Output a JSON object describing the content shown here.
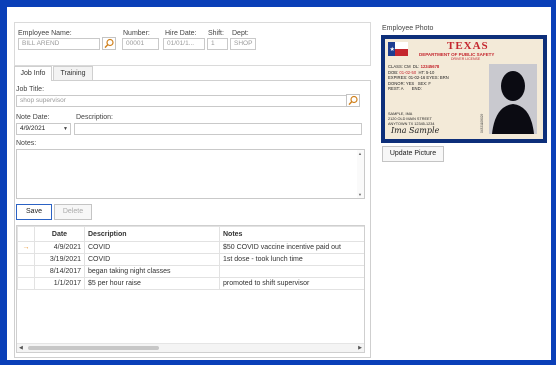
{
  "header": {
    "employee_name_label": "Employee Name:",
    "employee_name_value": "BILL AREND",
    "number_label": "Number:",
    "number_value": "00001",
    "hire_date_label": "Hire Date:",
    "hire_date_value": "01/01/1...",
    "shift_label": "Shift:",
    "shift_value": "1",
    "dept_label": "Dept:",
    "dept_value": "SHOP"
  },
  "tabs": [
    {
      "label": "Job Info",
      "active": true
    },
    {
      "label": "Training",
      "active": false
    }
  ],
  "job_info": {
    "job_title_label": "Job Title:",
    "job_title_value": "shop supervisor",
    "note_date_label": "Note Date:",
    "note_date_value": "4/9/2021",
    "description_label": "Description:",
    "description_value": "",
    "notes_label": "Notes:",
    "notes_value": "",
    "save_label": "Save",
    "delete_label": "Delete"
  },
  "table": {
    "columns": [
      "Date",
      "Description",
      "Notes"
    ],
    "rows": [
      {
        "date": "4/9/2021",
        "description": "COVID",
        "notes": "$50 COVID vaccine incentive paid out",
        "current": true
      },
      {
        "date": "3/19/2021",
        "description": "COVID",
        "notes": "1st dose - took lunch time",
        "current": false
      },
      {
        "date": "8/14/2017",
        "description": "began taking night classes",
        "notes": "",
        "current": false
      },
      {
        "date": "1/1/2017",
        "description": "$5 per hour raise",
        "notes": "promoted to shift supervisor",
        "current": false
      }
    ]
  },
  "photo": {
    "label": "Employee Photo",
    "update_label": "Update Picture",
    "card_title": "TEXAS",
    "card_dept": "DEPARTMENT OF PUBLIC SAFETY",
    "card_type": "DRIVER LICENSE",
    "card_class": "CLASS: CM",
    "card_dl_label": "DL:",
    "card_dl": "12345678",
    "card_dob_label": "DOB:",
    "card_dob": "01-02-50",
    "card_ht": "HT: 5-10",
    "card_expires": "EXPIRES: 01-02-16",
    "card_eyes": "EYES: BRN",
    "card_donor": "DONOR: YES",
    "card_sex": "SEX: F",
    "card_rest": "REST: A",
    "card_end": "END:",
    "card_name": "SAMPLE, IMA",
    "card_address1": "2120 OLD MAIN STREET",
    "card_address2": "ANYTOWN TX 12345-1234",
    "card_signature": "Ima Sample",
    "card_side_number": "04321108029"
  },
  "colors": {
    "frame": "#0a3fb8",
    "accent_blue": "#1e5bb8",
    "row_arrow": "#e8912c",
    "card_red": "#c4262e"
  }
}
